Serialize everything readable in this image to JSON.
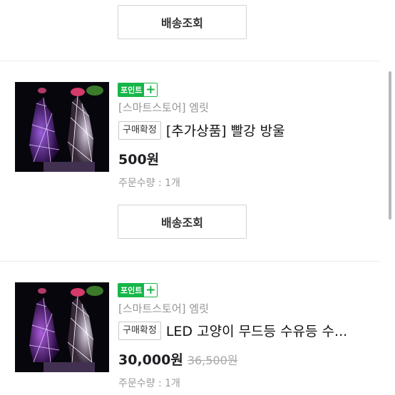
{
  "orders": [
    {
      "track_button": "배송조회"
    },
    {
      "point_label": "포인트",
      "point_plus": "+",
      "store": "[스마트스토어] 엠릿",
      "status_tag": "구매확정",
      "product_name": "[추가상품] 빨강 방울",
      "price": "500원",
      "original_price": "",
      "quantity": "주문수량 : 1개",
      "track_button": "배송조회"
    },
    {
      "point_label": "포인트",
      "point_plus": "+",
      "store": "[스마트스토어] 엠릿",
      "status_tag": "구매확정",
      "product_name": "LED 고양이 무드등 수유등 수...",
      "price": "30,000원",
      "original_price": "36,500원",
      "quantity": "주문수량 : 1개"
    }
  ],
  "colors": {
    "point_green": "#16b648",
    "text_gray": "#959595",
    "border": "#cfd2d6"
  }
}
